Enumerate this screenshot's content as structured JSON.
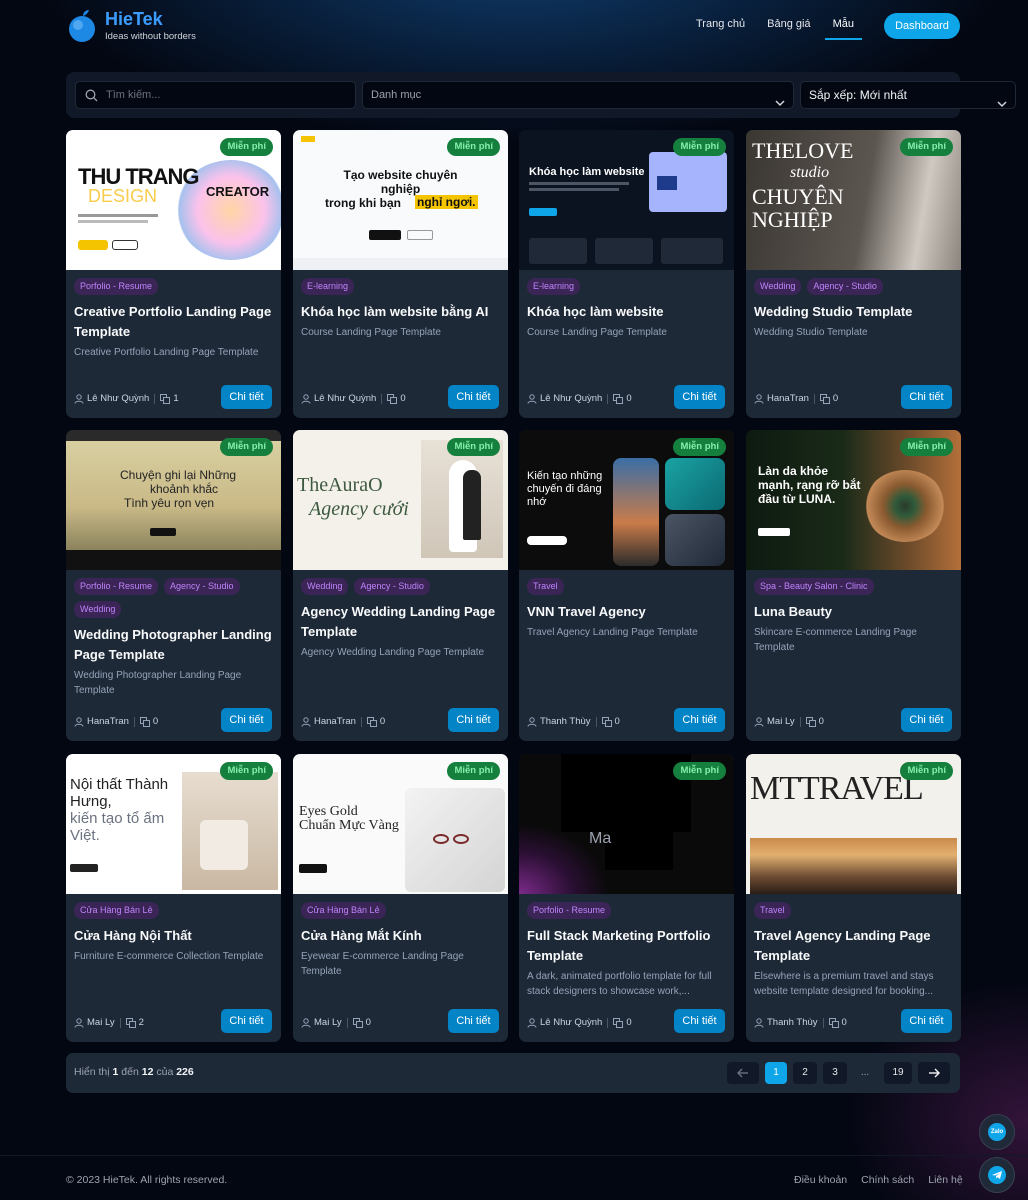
{
  "brand": {
    "name": "HieTek",
    "tagline": "Ideas without borders"
  },
  "nav": {
    "home": "Trang chủ",
    "pricing": "Bảng giá",
    "templates": "Mẫu",
    "dashboard": "Dashboard"
  },
  "filters": {
    "search_placeholder": "Tìm kiếm...",
    "category": "Danh mục",
    "sort": "Sắp xếp: Mới nhất"
  },
  "free_label": "Miễn phí",
  "detail_label": "Chi tiết",
  "cards": [
    {
      "tags": [
        "Porfolio - Resume"
      ],
      "title": "Creative Portfolio Landing Page Template",
      "desc": "Creative Portfolio Landing Page Template",
      "author": "Lê Như Quỳnh",
      "count": "1",
      "thumb": {
        "t1": "THU TRANG",
        "t2": "DESIGN",
        "t3": "CREATOR"
      }
    },
    {
      "tags": [
        "E-learning"
      ],
      "title": "Khóa học làm website bằng AI",
      "desc": "Course Landing Page Template",
      "author": "Lê Như Quỳnh",
      "count": "0",
      "thumb": {
        "t1": "Tạo website chuyên",
        "t2": "nghiệp",
        "t3": "trong khi bạn",
        "t4": "nghỉ ngơi."
      }
    },
    {
      "tags": [
        "E-learning"
      ],
      "title": "Khóa học làm website",
      "desc": "Course Landing Page Template",
      "author": "Lê Như Quỳnh",
      "count": "0",
      "thumb": {
        "t1": "Khóa học làm website"
      }
    },
    {
      "tags": [
        "Wedding",
        "Agency - Studio"
      ],
      "title": "Wedding Studio Template",
      "desc": "Wedding Studio Template",
      "author": "HanaTran",
      "count": "0",
      "thumb": {
        "t1": "THELOVE",
        "t2": "studio",
        "t3": "CHUYÊN",
        "t4": "NGHIỆP"
      }
    },
    {
      "tags": [
        "Porfolio - Resume",
        "Agency - Studio",
        "Wedding"
      ],
      "title": "Wedding Photographer Landing Page Template",
      "desc": "Wedding Photographer Landing Page Template",
      "author": "HanaTran",
      "count": "0",
      "thumb": {
        "t1": "Chuyện ghi lại Những",
        "t2": "khoảnh khắc",
        "t3": "Tình yêu  rọn vẹn"
      }
    },
    {
      "tags": [
        "Wedding",
        "Agency - Studio"
      ],
      "title": "Agency Wedding Landing Page Template",
      "desc": "Agency Wedding Landing Page Template",
      "author": "HanaTran",
      "count": "0",
      "thumb": {
        "t1": "TheAuraO",
        "t2": "Agency cưới"
      }
    },
    {
      "tags": [
        "Travel"
      ],
      "title": "VNN Travel Agency",
      "desc": "Travel Agency Landing Page Template",
      "author": "Thanh Thùy",
      "count": "0",
      "thumb": {
        "t1": "Kiến tạo những",
        "t2": "chuyến đi đáng",
        "t3": "nhớ"
      }
    },
    {
      "tags": [
        "Spa - Beauty Salon - Clinic"
      ],
      "title": "Luna Beauty",
      "desc": "Skincare E-commerce Landing Page Template",
      "author": "Mai Ly",
      "count": "0",
      "thumb": {
        "t1": "Làn da khỏe",
        "t2": "mạnh, rạng rỡ bắt",
        "t3": "đầu từ LUNA."
      }
    },
    {
      "tags": [
        "Cửa Hàng Bán Lẻ"
      ],
      "title": "Cửa Hàng Nội Thất",
      "desc": "Furniture E-commerce Collection Template",
      "author": "Mai Ly",
      "count": "2",
      "thumb": {
        "t1": "Nội thất Thành",
        "t2": "Hưng,",
        "t3": "kiến tạo tổ ấm",
        "t4": "Việt."
      }
    },
    {
      "tags": [
        "Cửa Hàng Bán Lẻ"
      ],
      "title": "Cửa Hàng Mắt Kính",
      "desc": "Eyewear E-commerce Landing Page Template",
      "author": "Mai Ly",
      "count": "0",
      "thumb": {
        "t1": "Eyes Gold",
        "t2": "Chuẩn Mực Vàng"
      }
    },
    {
      "tags": [
        "Porfolio - Resume"
      ],
      "title": "Full Stack Marketing Portfolio Template",
      "desc": "A dark, animated portfolio template for full stack designers to showcase work,...",
      "author": "Lê Như Quỳnh",
      "count": "0",
      "thumb": {
        "t1": "Ma"
      }
    },
    {
      "tags": [
        "Travel"
      ],
      "title": "Travel Agency Landing Page Template",
      "desc": "Elsewhere is a premium travel and stays website template designed for booking...",
      "author": "Thanh Thùy",
      "count": "0",
      "thumb": {
        "t1": "MTTRAVEL"
      }
    }
  ],
  "pagination": {
    "prefix": "Hiển thị",
    "from": "1",
    "mid": "đến",
    "to": "12",
    "of": "của",
    "total": "226",
    "pages": [
      "1",
      "2",
      "3",
      "...",
      "19"
    ]
  },
  "footer": {
    "copyright": "© 2023 HieTek. All rights reserved.",
    "terms": "Điều khoản",
    "policy": "Chính sách",
    "contact": "Liên hệ"
  },
  "fabs": {
    "zalo": "Zalo"
  }
}
